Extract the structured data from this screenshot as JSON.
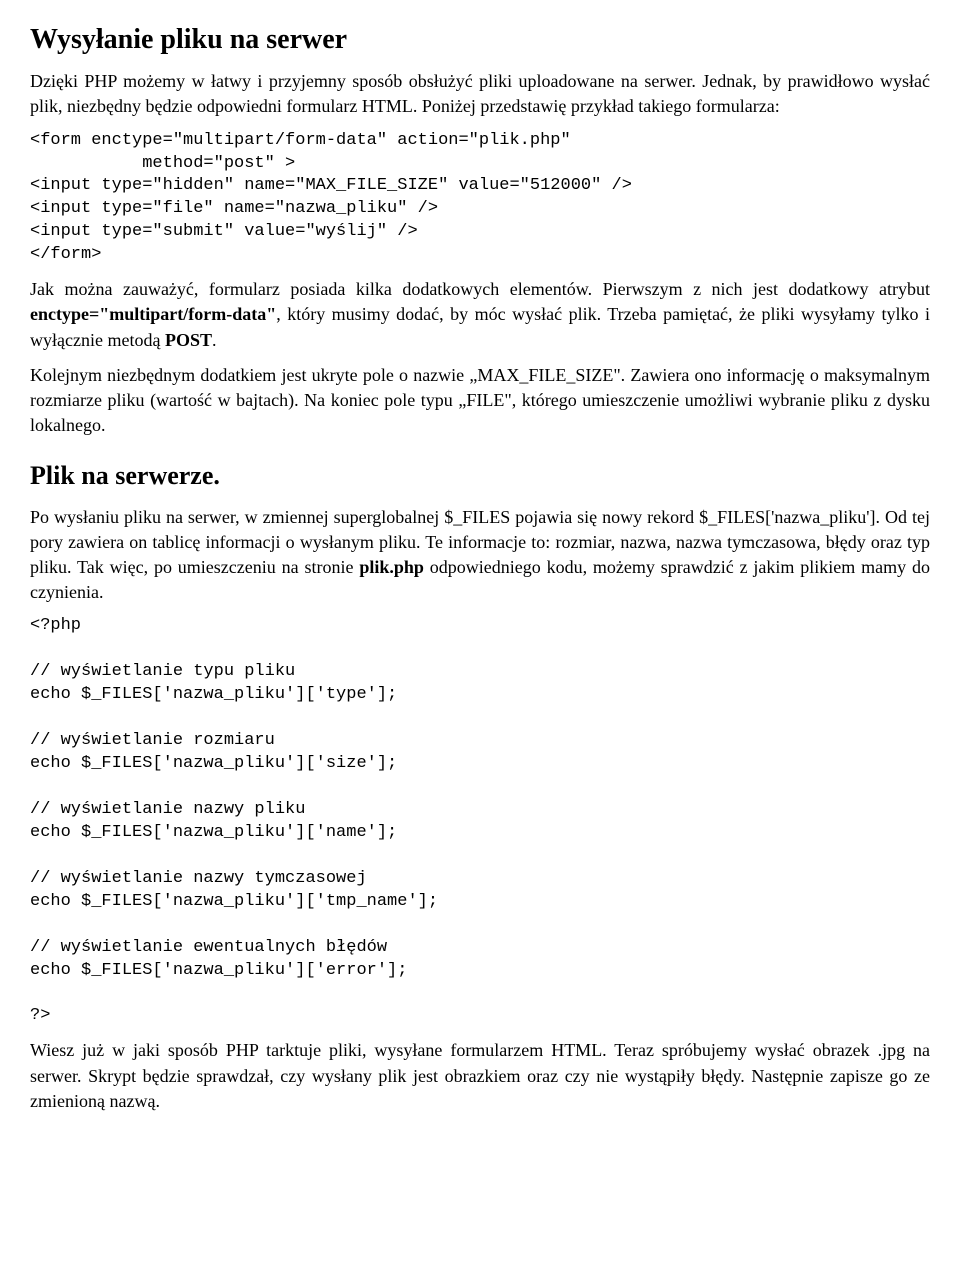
{
  "h1": "Wysyłanie pliku na serwer",
  "p1a": "Dzięki PHP możemy w łatwy i przyjemny sposób obsłużyć pliki uploadowane na serwer. Jednak, by prawidłowo wysłać plik, niezbędny będzie odpowiedni formularz HTML. Poniżej przedstawię przykład takiego formularza:",
  "code1": "<form enctype=\"multipart/form-data\" action=\"plik.php\"\n           method=\"post\" >\n<input type=\"hidden\" name=\"MAX_FILE_SIZE\" value=\"512000\" />\n<input type=\"file\" name=\"nazwa_pliku\" />\n<input type=\"submit\" value=\"wyślij\" />\n</form>",
  "p2_pre": "Jak można zauważyć, formularz posiada kilka dodatkowych elementów. Pierwszym z nich jest dodatkowy atrybut ",
  "p2_bold1": "enctype=\"multipart/form-data\"",
  "p2_mid": ", który musimy dodać, by móc wysłać plik. Trzeba pamiętać, że pliki wysyłamy tylko i wyłącznie metodą ",
  "p2_bold2": "POST",
  "p2_end": ".",
  "p3": "Kolejnym niezbędnym dodatkiem jest ukryte pole o nazwie „MAX_FILE_SIZE\". Zawiera ono informację o maksymalnym rozmiarze pliku (wartość w bajtach). Na koniec pole typu „FILE\", którego umieszczenie umożliwi wybranie pliku z dysku lokalnego.",
  "h2": "Plik na serwerze.",
  "p4_pre": "Po wysłaniu pliku na serwer, w zmiennej superglobalnej $_FILES pojawia się nowy rekord $_FILES['nazwa_pliku']. Od tej pory zawiera on tablicę informacji o wysłanym pliku. Te informacje to: rozmiar, nazwa, nazwa tymczasowa, błędy oraz typ pliku. Tak więc, po umieszczeniu na stronie ",
  "p4_bold": "plik.php",
  "p4_end": " odpowiedniego kodu, możemy sprawdzić z jakim plikiem mamy do czynienia.",
  "code2": "<?php\n\n// wyświetlanie typu pliku\necho $_FILES['nazwa_pliku']['type'];\n\n// wyświetlanie rozmiaru\necho $_FILES['nazwa_pliku']['size'];\n\n// wyświetlanie nazwy pliku\necho $_FILES['nazwa_pliku']['name'];\n\n// wyświetlanie nazwy tymczasowej\necho $_FILES['nazwa_pliku']['tmp_name'];\n\n// wyświetlanie ewentualnych błędów\necho $_FILES['nazwa_pliku']['error'];\n\n?>",
  "p5": "Wiesz już w jaki sposób PHP tarktuje pliki, wysyłane formularzem HTML. Teraz spróbujemy wysłać obrazek .jpg na serwer. Skrypt będzie sprawdzał, czy wysłany plik jest obrazkiem oraz czy nie wystąpiły błędy. Następnie zapisze go ze zmienioną nazwą."
}
